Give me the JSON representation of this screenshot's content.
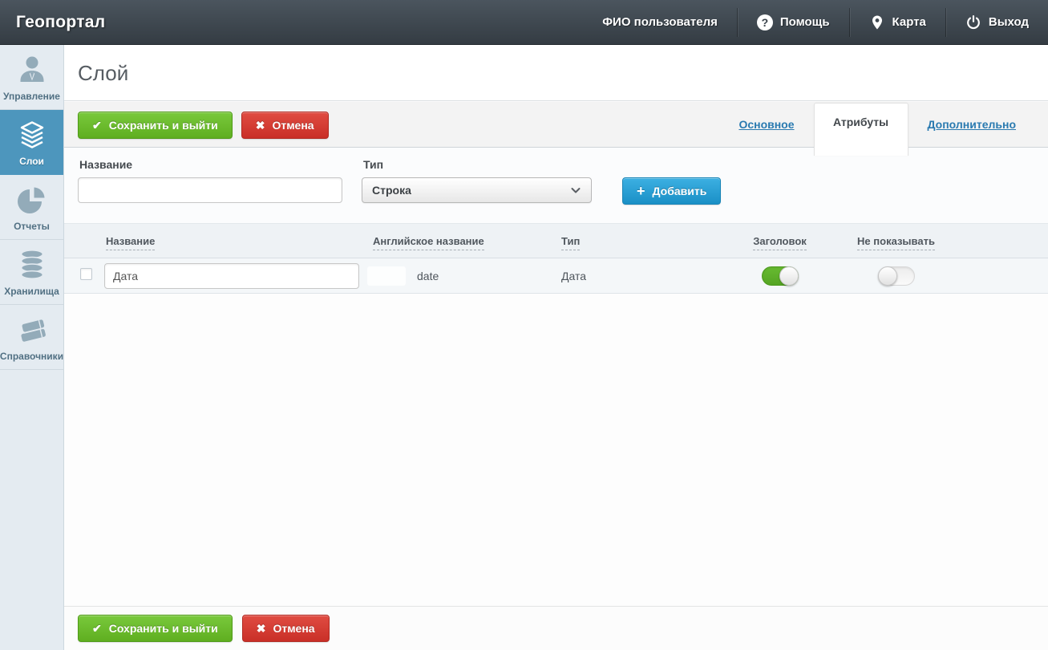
{
  "header": {
    "brand": "Геопортал",
    "user": "ФИО пользователя",
    "menu": {
      "help": "Помощь",
      "map": "Карта",
      "exit": "Выход"
    }
  },
  "sidebar": {
    "items": [
      {
        "label": "Управление",
        "icon": "user-icon",
        "active": false
      },
      {
        "label": "Слои",
        "icon": "layers-icon",
        "active": true
      },
      {
        "label": "Отчеты",
        "icon": "pie-chart-icon",
        "active": false
      },
      {
        "label": "Хранилища",
        "icon": "database-icon",
        "active": false
      },
      {
        "label": "Справочники",
        "icon": "books-icon",
        "active": false
      }
    ]
  },
  "page": {
    "title": "Слой"
  },
  "toolbar": {
    "save_label": "Сохранить и выйти",
    "cancel_label": "Отмена"
  },
  "tabs": [
    {
      "label": "Основное",
      "active": false
    },
    {
      "label": "Атрибуты",
      "active": true
    },
    {
      "label": "Дополнительно",
      "active": false
    }
  ],
  "form": {
    "name_label": "Название",
    "name_value": "",
    "name_placeholder": "",
    "type_label": "Тип",
    "type_value": "Строка",
    "add_label": "Добавить"
  },
  "table": {
    "columns": [
      "Название",
      "Английское название",
      "Тип",
      "Заголовок",
      "Не показывать"
    ],
    "rows": [
      {
        "checked": false,
        "name": "Дата",
        "english_name": "date",
        "type": "Дата",
        "header_toggle": true,
        "hide_toggle": false
      }
    ]
  },
  "footer": {
    "save_label": "Сохранить и выйти",
    "cancel_label": "Отмена"
  },
  "colors": {
    "topbar_dark": "#3a434b",
    "sidebar_bg": "#e4ebf1",
    "active_item_blue": "#4d96bd",
    "button_green": "#67b724",
    "button_red": "#d2322c",
    "button_blue": "#26a0d4",
    "link_blue": "#2a7ab0",
    "toggle_on_green": "#5fb32c"
  }
}
